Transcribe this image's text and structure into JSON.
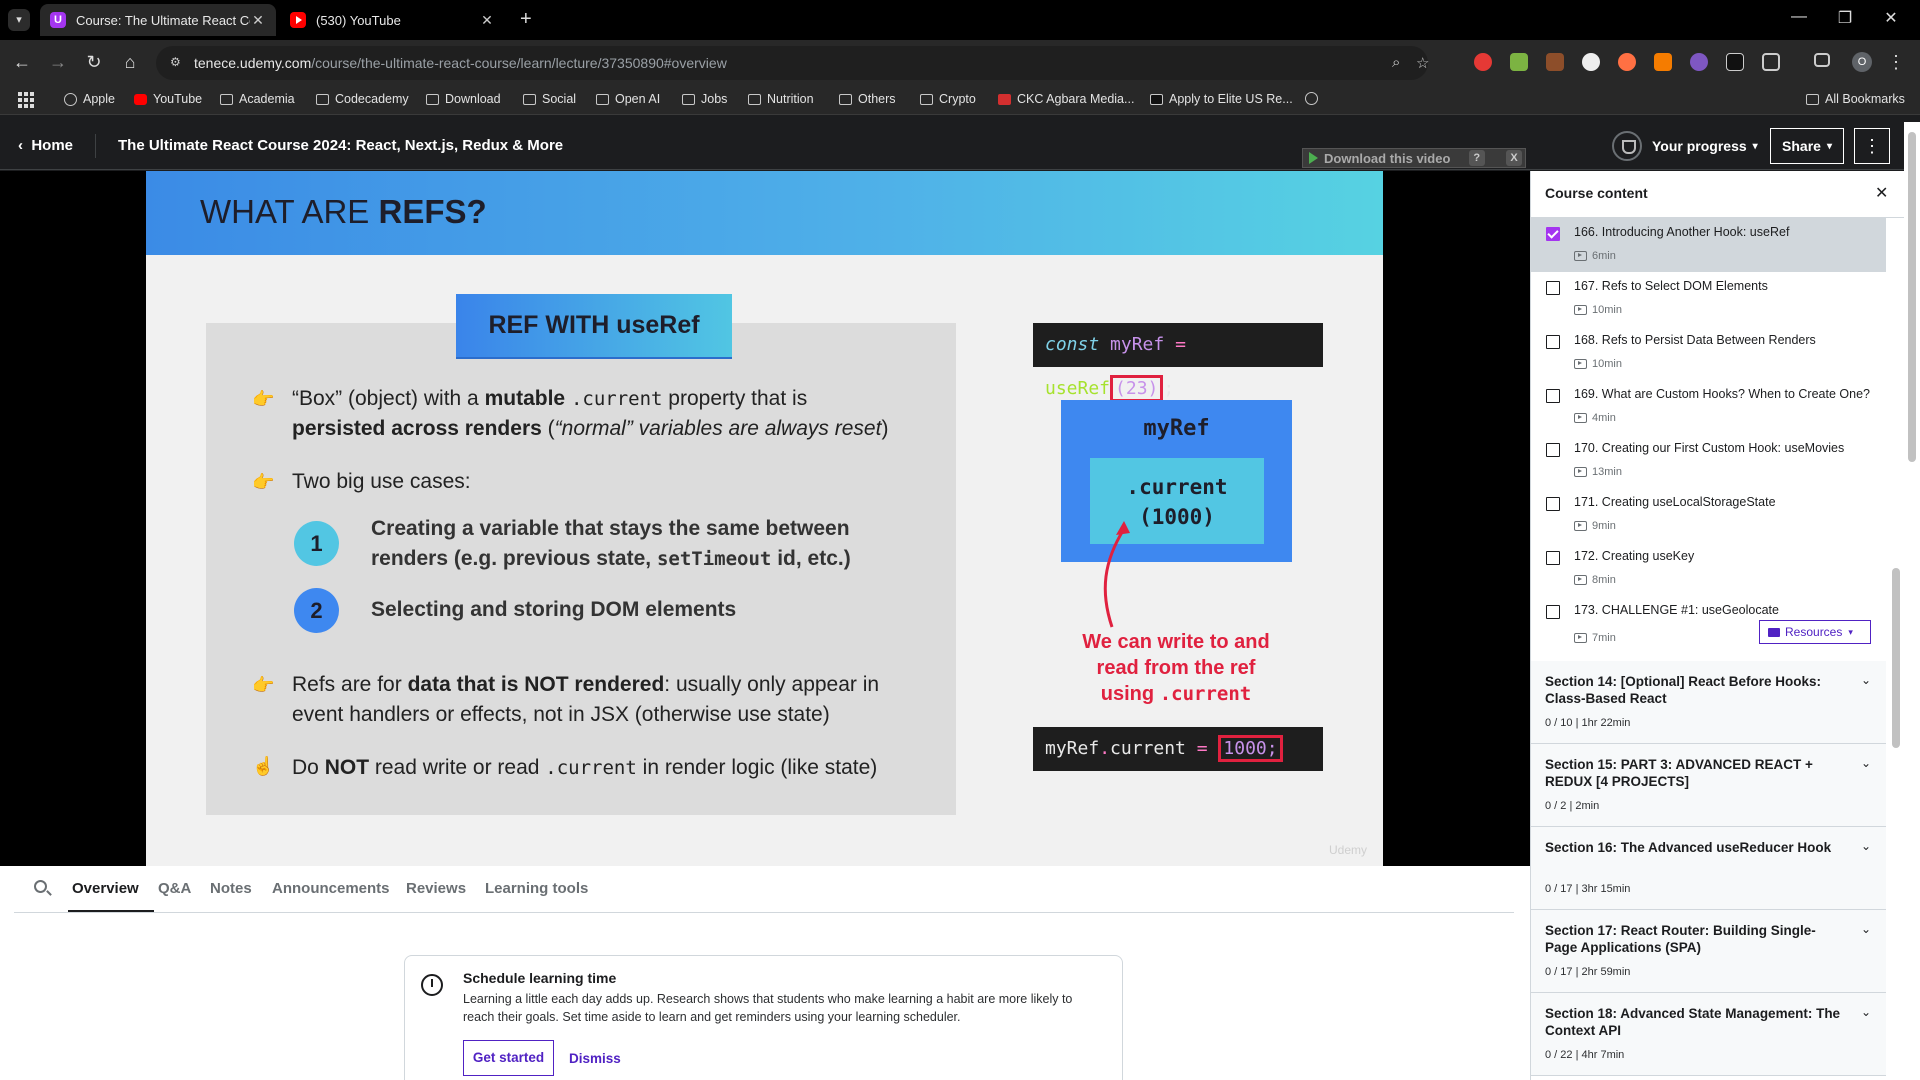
{
  "browser": {
    "tabs": [
      {
        "title": "Course: The Ultimate React Cou",
        "active": true,
        "icon": "udemy-favicon"
      },
      {
        "title": "(530) YouTube",
        "active": false,
        "icon": "youtube-favicon"
      }
    ],
    "url_host": "tenece.udemy.com",
    "url_path": "/course/the-ultimate-react-course/learn/lecture/37350890#overview",
    "profile_initial": "O",
    "bookmarks": [
      "Apple",
      "YouTube",
      "Academia",
      "Codecademy",
      "Download",
      "Social",
      "Open AI",
      "Jobs",
      "Nutrition",
      "Others",
      "Crypto",
      "CKC Agbara Media...",
      "Apply to Elite US Re..."
    ],
    "all_bookmarks": "All Bookmarks",
    "extensions": [
      "abp-icon",
      "chart-icon",
      "wave-icon",
      "face-icon",
      "star-icon",
      "fox-icon",
      "discord-icon",
      "slash-icon",
      "puzzle-icon"
    ]
  },
  "header": {
    "home": "Home",
    "course_title": "The Ultimate React Course 2024: React, Next.js, Redux & More",
    "progress": "Your progress",
    "share": "Share",
    "more": "⋮"
  },
  "download_bar": {
    "label": "Download this video",
    "help": "?",
    "close": "X"
  },
  "slide": {
    "heading_pre": "WHAT ARE",
    "heading_bold": "REFS?",
    "tag": "REF WITH useRef",
    "b1_a": "“Box” (object) with a",
    "b1_b": "mutable",
    "b1_c": ".current",
    "b1_d": "property that is",
    "b1_e": "persisted across renders",
    "b1_f": "(",
    "b1_g": "“normal” variables are always reset",
    "b1_h": ")",
    "b2": "Two big use cases:",
    "uc1_num": "1",
    "uc1_a": "Creating a variable that stays the same between",
    "uc1_b": "renders (e.g. previous state,",
    "uc1_c": "setTimeout",
    "uc1_d": "id, etc.)",
    "uc2_num": "2",
    "uc2": "Selecting and storing DOM elements",
    "b3_a": "Refs are for",
    "b3_b": "data that is NOT rendered",
    "b3_c": ": usually only appear in",
    "b3_d": "event handlers or effects, not in JSX (otherwise use state)",
    "b4_a": "Do",
    "b4_b": "NOT",
    "b4_c": "read write or read",
    "b4_d": ".current",
    "b4_e": "in render logic (like state)",
    "code1_kw": "const",
    "code1_var": "myRef",
    "code1_eq": "=",
    "code1_fn": "useRef",
    "code1_arg": "(23)",
    "code1_end": ";",
    "box_label": "myRef",
    "box_current": ".current",
    "box_value": "(1000)",
    "note_1": "We can write to and",
    "note_2": "read from the ref",
    "note_3": "using",
    "note_code": ".current",
    "code2_obj": "myRef",
    "code2_dot": ".",
    "code2_prop": "current",
    "code2_eq": "=",
    "code2_val": "1000;",
    "watermark": "Udemy"
  },
  "lower_tabs": [
    "Overview",
    "Q&A",
    "Notes",
    "Announcements",
    "Reviews",
    "Learning tools"
  ],
  "schedule": {
    "title": "Schedule learning time",
    "text": "Learning a little each day adds up. Research shows that students who make learning a habit are more likely to reach their goals. Set time aside to learn and get reminders using your learning scheduler.",
    "get_started": "Get started",
    "dismiss": "Dismiss"
  },
  "sidebar": {
    "title": "Course content",
    "close": "✕",
    "lectures": [
      {
        "title": "166. Introducing Another Hook: useRef",
        "duration": "6min",
        "checked": true,
        "current": true
      },
      {
        "title": "167. Refs to Select DOM Elements",
        "duration": "10min",
        "checked": false
      },
      {
        "title": "168. Refs to Persist Data Between Renders",
        "duration": "10min",
        "checked": false
      },
      {
        "title": "169. What are Custom Hooks? When to Create One?",
        "duration": "4min",
        "checked": false
      },
      {
        "title": "170. Creating our First Custom Hook: useMovies",
        "duration": "13min",
        "checked": false
      },
      {
        "title": "171. Creating useLocalStorageState",
        "duration": "9min",
        "checked": false
      },
      {
        "title": "172. Creating useKey",
        "duration": "8min",
        "checked": false
      },
      {
        "title": "173. CHALLENGE #1: useGeolocate",
        "duration": "7min",
        "checked": false
      }
    ],
    "resources": "Resources",
    "sections": [
      {
        "title": "Section 14: [Optional] React Before Hooks: Class-Based React",
        "meta": "0 / 10 | 1hr 22min"
      },
      {
        "title": "Section 15: PART 3: ADVANCED REACT + REDUX [4 PROJECTS]",
        "meta": "0 / 2 | 2min"
      },
      {
        "title": "Section 16: The Advanced useReducer Hook",
        "meta": "0 / 17 | 3hr 15min"
      },
      {
        "title": "Section 17: React Router: Building Single-Page Applications (SPA)",
        "meta": "0 / 17 | 2hr 59min"
      },
      {
        "title": "Section 18: Advanced State Management: The Context API",
        "meta": "0 / 22 | 4hr 7min"
      }
    ]
  }
}
